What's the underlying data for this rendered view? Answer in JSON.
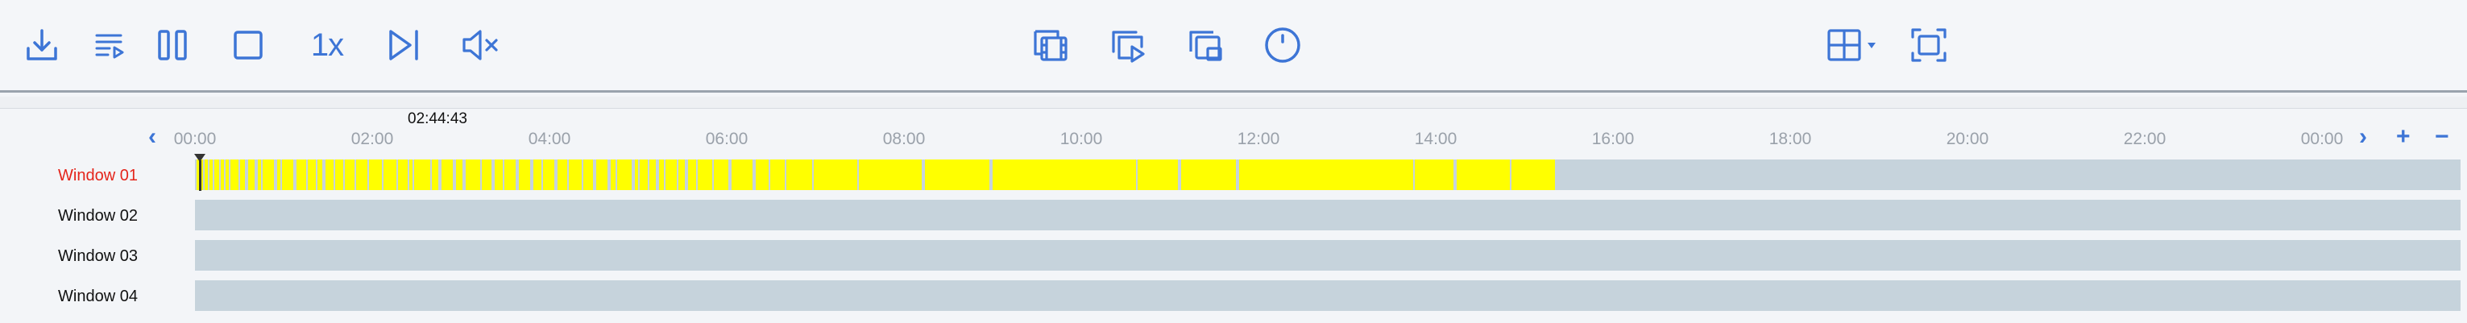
{
  "toolbar": {
    "left_buttons": [
      {
        "name": "download-button",
        "icon": "download-icon"
      },
      {
        "name": "playlist-button",
        "icon": "playlist-play-icon"
      },
      {
        "name": "pause-button",
        "icon": "pause-icon"
      },
      {
        "name": "stop-button",
        "icon": "stop-icon"
      },
      {
        "name": "speed-button",
        "icon": "speed-icon",
        "label": "1x"
      },
      {
        "name": "next-frame-button",
        "icon": "skip-next-icon"
      },
      {
        "name": "mute-button",
        "icon": "mute-icon"
      }
    ],
    "center_buttons": [
      {
        "name": "clip-button",
        "icon": "film-clip-icon"
      },
      {
        "name": "sync-play-button",
        "icon": "multi-play-icon"
      },
      {
        "name": "multi-window-button",
        "icon": "multi-window-icon"
      },
      {
        "name": "digital-zoom-button",
        "icon": "circle-icon"
      }
    ],
    "right_buttons": [
      {
        "name": "layout-button",
        "icon": "grid-layout-icon"
      },
      {
        "name": "fullscreen-button",
        "icon": "fullscreen-icon"
      }
    ],
    "accent_color": "#3d75d6"
  },
  "timeline": {
    "cursor_time": "02:44:43",
    "ruler": [
      "00:00",
      "02:00",
      "04:00",
      "06:00",
      "08:00",
      "10:00",
      "12:00",
      "14:00",
      "16:00",
      "18:00",
      "20:00",
      "22:00",
      "00:00"
    ],
    "nav": {
      "prev": "‹",
      "next": "›",
      "zoom_in": "+",
      "zoom_out": "−"
    },
    "windows": [
      {
        "label": "Window 01",
        "active": true
      },
      {
        "label": "Window 02",
        "active": false
      },
      {
        "label": "Window 03",
        "active": false
      },
      {
        "label": "Window 04",
        "active": false
      }
    ],
    "recording": {
      "color": "#ffff00",
      "track_color": "#c6d3dc",
      "start_hour": 0.02,
      "end_hour": 15.35,
      "playhead_hour": 0.05
    }
  }
}
